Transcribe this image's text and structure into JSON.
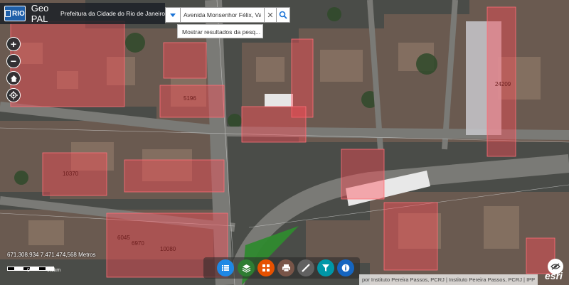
{
  "header": {
    "logo_text": "RIO",
    "app_title": "Geo PAL",
    "subtitle": "Prefeitura da Cidade do Rio de Janeiro"
  },
  "search": {
    "value": "Avenida Monsenhor Félix, Vaz",
    "suggestion": "Mostrar resultados da pesq..."
  },
  "nav": {
    "zoom_in": "+",
    "zoom_out": "−"
  },
  "map": {
    "parcel_labels": [
      "5196",
      "24209",
      "10370",
      "6045",
      "6970",
      "10080"
    ],
    "coordinates": "671.308.934 7.471.474,568 Metros",
    "scale_labels": [
      "0",
      "0,1km"
    ]
  },
  "toolbar": {
    "tools": [
      {
        "name": "list-icon",
        "color": "#1e88e5"
      },
      {
        "name": "layers-icon",
        "color": "#2e7d32"
      },
      {
        "name": "grid-icon",
        "color": "#e65100"
      },
      {
        "name": "print-icon",
        "color": "#795548"
      },
      {
        "name": "measure-icon",
        "color": "#616161"
      },
      {
        "name": "filter-icon",
        "color": "#0097a7"
      },
      {
        "name": "info-icon",
        "color": "#1565c0"
      }
    ]
  },
  "attribution": "por Instituto Pereira Passos, PCRJ | Instituto Pereira Passos, PCRJ | IPP",
  "esri": "esri"
}
